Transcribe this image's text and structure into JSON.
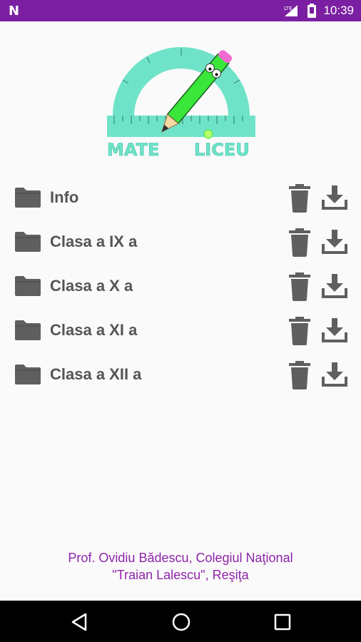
{
  "status_bar": {
    "app_indicator": "N",
    "network": "LTE",
    "time": "10:39",
    "icons": [
      "app-notification-icon",
      "signal-icon",
      "battery-icon"
    ]
  },
  "logo": {
    "text_left": "MATE",
    "text_right": "LICEU"
  },
  "folders": [
    {
      "label": "Info"
    },
    {
      "label": "Clasa a IX a"
    },
    {
      "label": "Clasa a X a"
    },
    {
      "label": "Clasa a XI a"
    },
    {
      "label": "Clasa a XII a"
    }
  ],
  "row_icons": {
    "folder": "folder-icon",
    "delete": "trash-icon",
    "download": "download-icon"
  },
  "footer": {
    "line1": "Prof. Ovidiu Bădescu, Colegiul Naţional",
    "line2": "\"Traian Lalescu\", Reşiţa"
  },
  "nav_bar": {
    "icons": [
      "back-icon",
      "home-icon",
      "recents-icon"
    ]
  },
  "colors": {
    "status_bar": "#7b1fa2",
    "footer_text": "#8e24aa",
    "icon_gray": "#5f5f5f",
    "logo_accent": "#6fe3c8"
  }
}
